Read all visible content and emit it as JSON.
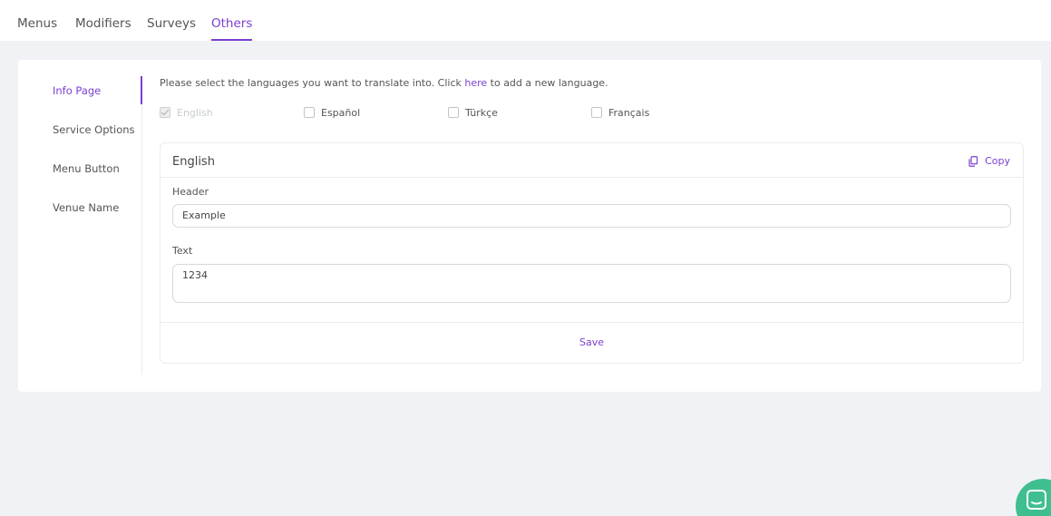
{
  "top_tabs": [
    {
      "label": "Menus"
    },
    {
      "label": "Modifiers"
    },
    {
      "label": "Surveys"
    },
    {
      "label": "Others"
    }
  ],
  "active_top_tab": "Others",
  "sidebar": {
    "items": [
      {
        "label": "Info Page"
      },
      {
        "label": "Service Options"
      },
      {
        "label": "Menu Button"
      },
      {
        "label": "Venue Name"
      }
    ],
    "active": "Info Page"
  },
  "languages": {
    "instruction_before": "Please select the languages you want to translate into. Click ",
    "instruction_link": "here",
    "instruction_after": " to add a new language.",
    "options": [
      {
        "label": "English",
        "checked": true,
        "disabled": true
      },
      {
        "label": "Español",
        "checked": false,
        "disabled": false
      },
      {
        "label": "Türkçe",
        "checked": false,
        "disabled": false
      },
      {
        "label": "Français",
        "checked": false,
        "disabled": false
      }
    ]
  },
  "panel": {
    "title": "English",
    "copy_label": "Copy",
    "header_label": "Header",
    "header_value": "Example",
    "text_label": "Text",
    "text_value": "1234",
    "save_label": "Save"
  },
  "colors": {
    "accent": "#7a3fd1",
    "chat": "#3fbf8f",
    "background": "#f1f2f5"
  }
}
